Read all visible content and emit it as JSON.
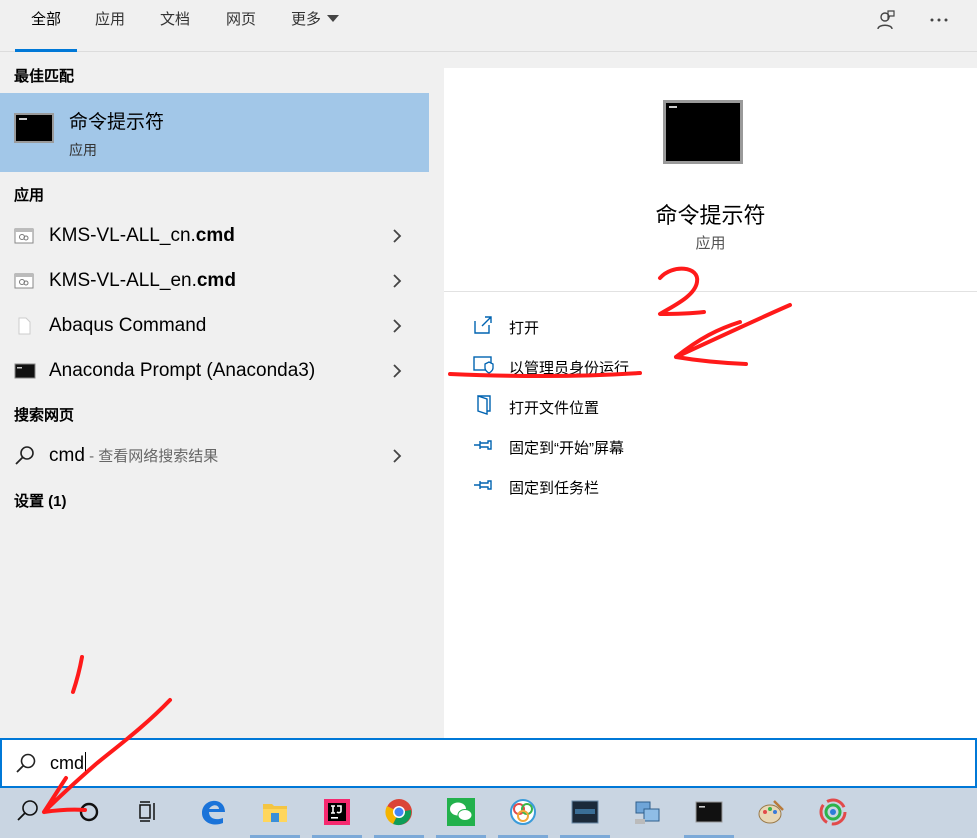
{
  "tabs": [
    {
      "label": "全部",
      "active": true
    },
    {
      "label": "应用"
    },
    {
      "label": "文档"
    },
    {
      "label": "网页"
    },
    {
      "label": "更多"
    }
  ],
  "top_icons": [
    "feedback-icon",
    "more-options-icon"
  ],
  "left": {
    "best_match_title": "最佳匹配",
    "best_match": {
      "name": "命令提示符",
      "type": "应用",
      "icon": "command-prompt-icon"
    },
    "apps_title": "应用",
    "apps": [
      {
        "prefix": "KMS-VL-ALL_cn.",
        "bold": "cmd",
        "icon": "script-icon"
      },
      {
        "prefix": "KMS-VL-ALL_en.",
        "bold": "cmd",
        "icon": "script-icon"
      },
      {
        "prefix": "Abaqus Command",
        "bold": "",
        "icon": "file-icon"
      },
      {
        "prefix": "Anaconda Prompt (Anaconda3)",
        "bold": "",
        "icon": "console-icon"
      }
    ],
    "web_title": "搜索网页",
    "web": {
      "query": "cmd",
      "hint": " - 查看网络搜索结果"
    },
    "settings_title": "设置 (1)"
  },
  "right": {
    "name": "命令提示符",
    "type": "应用",
    "actions": [
      {
        "label": "打开",
        "icon": "open-icon"
      },
      {
        "label": "以管理员身份运行",
        "icon": "run-as-admin-icon"
      },
      {
        "label": "打开文件位置",
        "icon": "file-location-icon"
      },
      {
        "label": "固定到“开始”屏幕",
        "icon": "pin-start-icon"
      },
      {
        "label": "固定到任务栏",
        "icon": "pin-taskbar-icon"
      }
    ]
  },
  "search": {
    "value": "cmd"
  },
  "taskbar": [
    "search-icon",
    "cortana-icon",
    "task-view-icon",
    "edge-icon",
    "file-explorer-icon",
    "intellij-icon",
    "chrome-icon",
    "wechat-icon",
    "navicat-icon",
    "mysql-icon",
    "network-icon",
    "cmd-icon",
    "paint-icon",
    "tencent-meeting-icon"
  ],
  "annotations": {
    "step1": "1",
    "step2": "2"
  },
  "colors": {
    "accent": "#0078d7",
    "selected": "#a2c7e8",
    "annotation": "#ff1a1a"
  }
}
